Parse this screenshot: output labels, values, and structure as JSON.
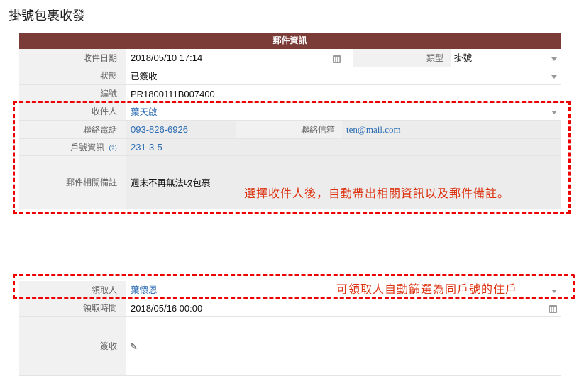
{
  "page": {
    "title": "掛號包裹收發"
  },
  "section": {
    "title": "郵件資訊"
  },
  "fields": {
    "received_date": {
      "label": "收件日期",
      "value": "2018/05/10 17:14"
    },
    "type": {
      "label": "類型",
      "value": "掛號"
    },
    "status": {
      "label": "狀態",
      "value": "已簽收"
    },
    "serial": {
      "label": "編號",
      "value": "PR1800111B007400"
    },
    "recipient": {
      "label": "收件人",
      "value": "葉天啟"
    },
    "phone": {
      "label": "聯絡電話",
      "value": "093-826-6926"
    },
    "email": {
      "label": "聯絡信箱",
      "value": "ten@mail.com"
    },
    "household": {
      "label": "戶號資訊",
      "help": "(?)",
      "value": "231-3-5"
    },
    "remark": {
      "label": "郵件相關備註",
      "value": "週末不再無法收包裹"
    },
    "pickup_person": {
      "label": "領取人",
      "value": "葉懷恩"
    },
    "pickup_time": {
      "label": "領取時間",
      "value": "2018/05/16 00:00"
    },
    "signature": {
      "label": "簽收"
    }
  },
  "annotations": {
    "note1": "選擇收件人後，自動帶出相關資訊以及郵件備註。",
    "note2": "可領取人自動篩選為同戶號的住戶"
  },
  "colors": {
    "header": "#7b3b37",
    "annotation": "#e00",
    "link": "#2a6bb3"
  },
  "icons": {
    "calendar": "calendar-icon",
    "dropdown": "chevron-down-icon",
    "edit": "pen-icon"
  }
}
